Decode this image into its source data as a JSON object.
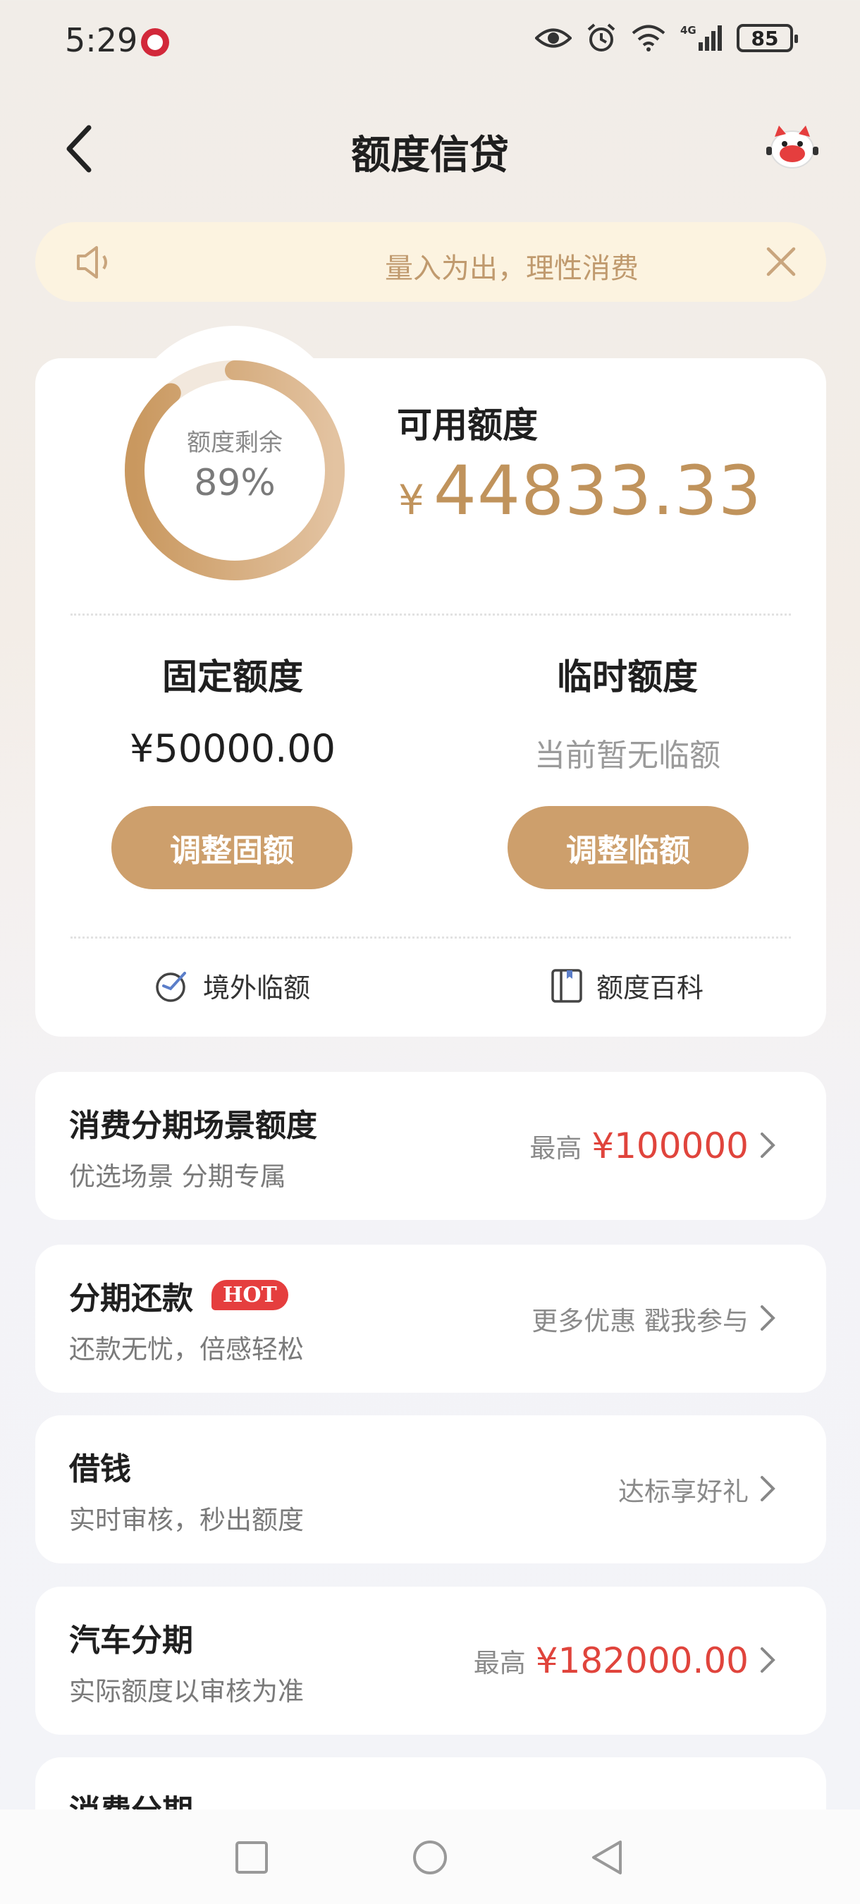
{
  "status": {
    "time": "5:29",
    "battery": "85",
    "network": "4G"
  },
  "header": {
    "title": "额度信贷"
  },
  "notice": {
    "text": "量入为出，理性消费"
  },
  "limit": {
    "ring_label": "额度剩余",
    "ring_percent": "89%",
    "ring_fraction": 0.89,
    "available_label": "可用额度",
    "currency": "¥",
    "available_amount": "44833.33",
    "fixed_title": "固定额度",
    "fixed_amount": "¥50000.00",
    "temp_title": "临时额度",
    "temp_status": "当前暂无临额",
    "adjust_fixed": "调整固额",
    "adjust_temp": "调整临额",
    "overseas_link": "境外临额",
    "wiki_link": "额度百科"
  },
  "list": [
    {
      "title": "消费分期场景额度",
      "subtitle": "优选场景 分期专属",
      "right_prefix": "最高",
      "right_value": "¥100000"
    },
    {
      "title": "分期还款",
      "badge": "HOT",
      "subtitle": "还款无忧，倍感轻松",
      "right_text": "更多优惠 戳我参与"
    },
    {
      "title": "借钱",
      "subtitle": "实时审核，秒出额度",
      "right_text": "达标享好礼"
    },
    {
      "title": "汽车分期",
      "subtitle": "实际额度以审核为准",
      "right_prefix": "最高",
      "right_value": "¥182000.00"
    },
    {
      "title": "消费分期"
    }
  ],
  "colors": {
    "gold": "#cd9f6c",
    "amount_gold": "#c0935c",
    "red": "#e0443c",
    "notice_bg": "#fcf3e0"
  }
}
